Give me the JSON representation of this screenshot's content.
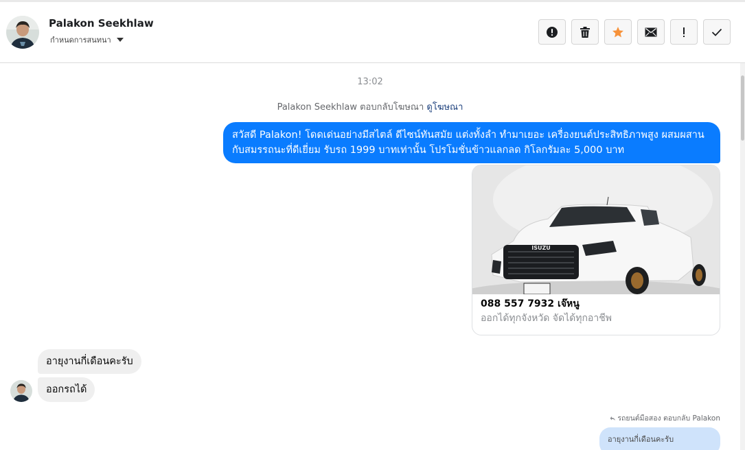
{
  "header": {
    "contact_name": "Palakon Seekhlaw",
    "assign_label": "กำหนดการสนทนา",
    "actions": [
      {
        "name": "report-spam-button",
        "icon": "alert-circle-icon"
      },
      {
        "name": "delete-button",
        "icon": "trash-icon"
      },
      {
        "name": "star-button",
        "icon": "star-icon"
      },
      {
        "name": "mark-unread-button",
        "icon": "envelope-icon"
      },
      {
        "name": "follow-up-button",
        "icon": "exclamation-icon"
      },
      {
        "name": "mark-done-button",
        "icon": "checkmark-icon"
      }
    ]
  },
  "chat": {
    "timestamp": "13:02",
    "ad_reply_text": "Palakon Seekhlaw ตอบกลับโฆษณา",
    "ad_link": "ดูโฆษณา",
    "outgoing_message": "สวัสดี Palakon! โดดเด่นอย่างมีสไตล์ ดีไซน์ทันสมัย แต่งทั้งลำ ทำมาเยอะ เครื่องยนต์ประสิทธิภาพสูง ผสมผสานกับสมรรถนะที่ดีเยี่ยม รับรถ 1999 บาทเท่านั้น โปรโมชั่นข้าวแลกลด กิโลกรัมละ 5,000 บาท",
    "ad_card": {
      "title": "088 557 7932 เจ๊หนู",
      "subtitle": "ออกได้ทุกจังหวัด จัดได้ทุกอาชีพ",
      "image_logo": "ISUZU"
    },
    "incoming": [
      "อายุงานกี่เดือนคะรับ",
      "ออกรถได้"
    ],
    "reply_note": "รถยนต์มือสอง ตอบกลับ Palakon",
    "reply_quote": "อายุงานกี่เดือนคะรับ"
  },
  "colors": {
    "accent": "#0a7cff",
    "star": "#f7923a",
    "incoming_bubble": "#efefef",
    "quote_bubble": "#cfe3fb"
  }
}
